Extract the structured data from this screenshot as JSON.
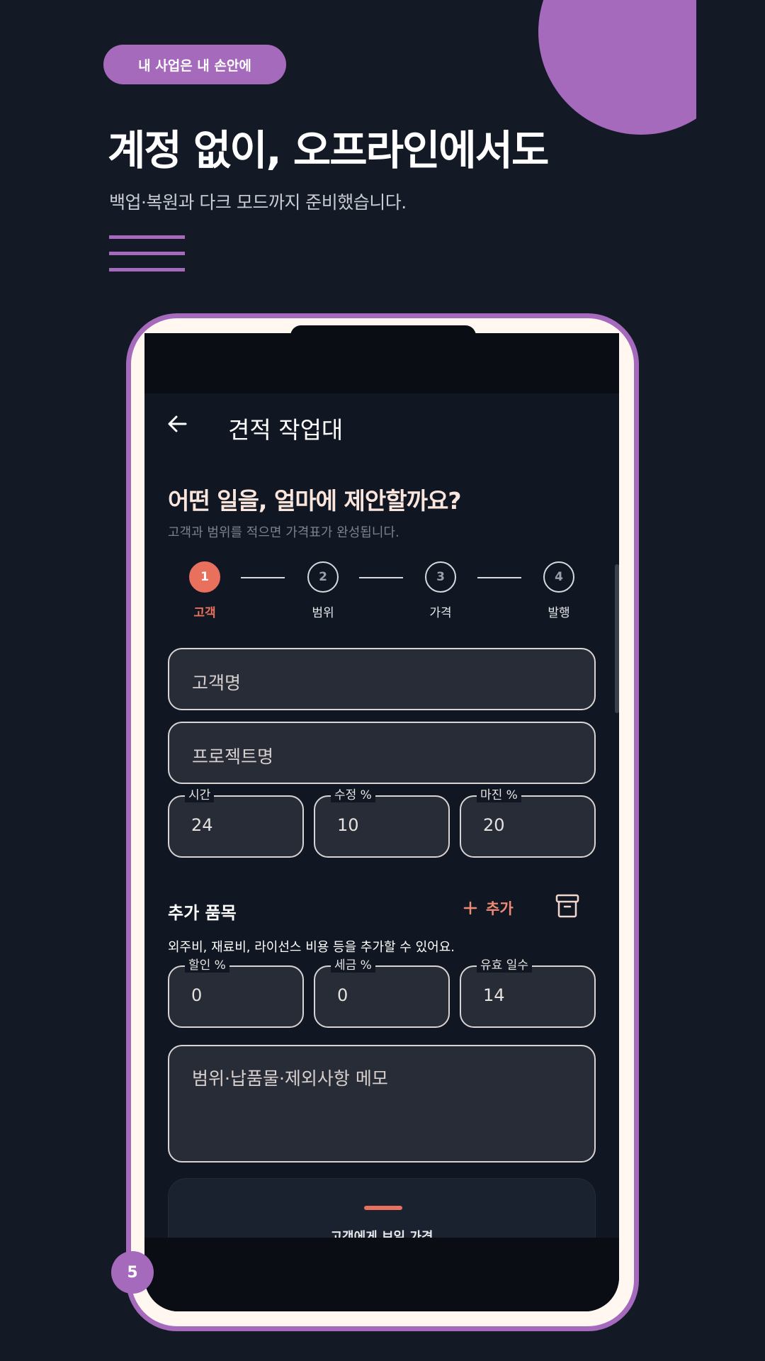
{
  "promo": {
    "pill": "내 사업은 내 손안에",
    "headline": "계정 없이, 오프라인에서도",
    "subline": "백업·복원과 다크 모드까지 준비했습니다.",
    "accent_color": "#a66abd",
    "page_number": "5"
  },
  "appbar": {
    "title": "견적 작업대",
    "back_icon": "arrow-left-icon"
  },
  "question": {
    "title": "어떤 일을, 얼마에 제안할까요?",
    "subtitle": "고객과 범위를 적으면 가격표가 완성됩니다."
  },
  "stepper": {
    "current": 1,
    "steps": [
      {
        "number": "1",
        "label": "고객"
      },
      {
        "number": "2",
        "label": "범위"
      },
      {
        "number": "3",
        "label": "가격"
      },
      {
        "number": "4",
        "label": "발행"
      }
    ]
  },
  "fields": {
    "client_name": {
      "placeholder": "고객명",
      "value": ""
    },
    "project_name": {
      "placeholder": "프로젝트명",
      "value": ""
    },
    "hours": {
      "label": "시간",
      "value": "24"
    },
    "revision": {
      "label": "수정 %",
      "value": "10"
    },
    "margin": {
      "label": "마진 %",
      "value": "20"
    },
    "discount": {
      "label": "할인 %",
      "value": "0"
    },
    "tax": {
      "label": "세금 %",
      "value": "0"
    },
    "valid_days": {
      "label": "유효 일수",
      "value": "14"
    },
    "memo": {
      "placeholder": "범위·납품물·제외사항 메모",
      "value": ""
    }
  },
  "extra_items": {
    "title": "추가 품목",
    "add_label": "추가",
    "add_icon": "plus-icon",
    "archive_icon": "archive-icon",
    "helper": "외주비, 재료비, 라이선스 비용 등을 추가할 수 있어요."
  },
  "summary": {
    "title": "고객에게 보일 가격"
  },
  "colors": {
    "primary": "#e8705c",
    "background": "#111722",
    "field": "#272c37"
  }
}
